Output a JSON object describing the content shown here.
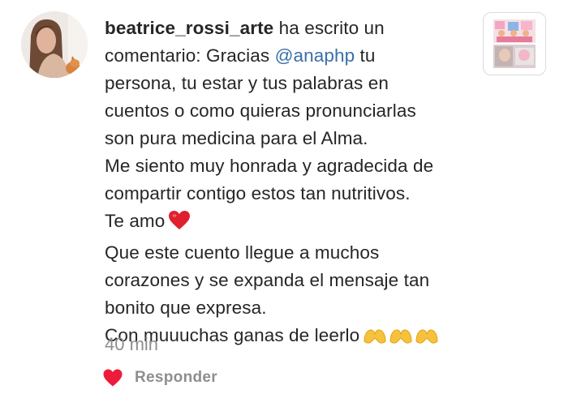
{
  "notification": {
    "username": "beatrice_rossi_arte",
    "action_text": " ha escrito un",
    "lines": [
      "comentario: Gracias ",
      "persona, tu estar y tus palabras en",
      "cuentos o como quieras pronunciarlas",
      "son pura medicina para el Alma.",
      "Me siento muy honrada y agradecida de",
      "compartir contigo estos tan nutritivos.",
      "Te amo",
      "Que este cuento llegue a muchos",
      "corazones y se expanda el mensaje tan",
      "bonito que expresa.",
      "Con muuuchas ganas de leerlo"
    ],
    "mention": "@anaphp",
    "mention_suffix": " tu",
    "timestamp": "40 min",
    "reply_label": "Responder",
    "icons": {
      "like": "heart-icon",
      "love_emoji": "red-heart-emoji",
      "hands_emoji": "heart-hands-emoji"
    },
    "colors": {
      "mention": "#3a6fa8",
      "heart": "#ed1c3a",
      "secondary_text": "#8e8e8e",
      "emoji_yellow": "#fbc531"
    }
  }
}
